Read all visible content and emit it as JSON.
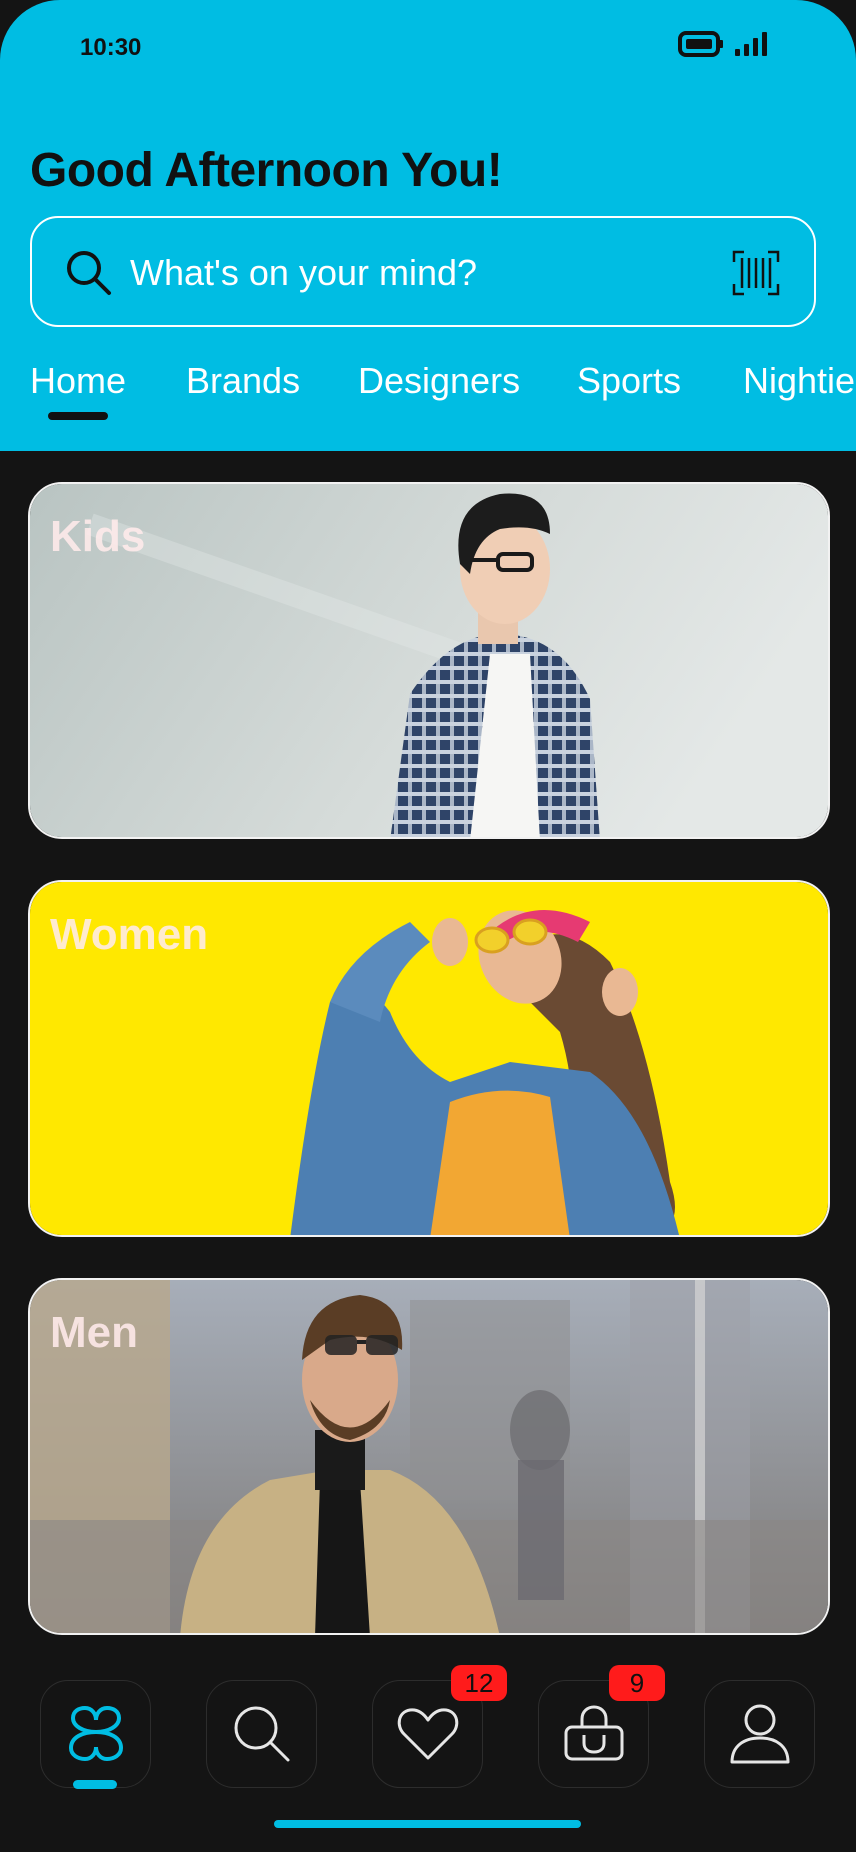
{
  "status_bar": {
    "time": "10:30"
  },
  "header": {
    "greeting": "Good Afternoon You!"
  },
  "search": {
    "placeholder": "What's on your mind?"
  },
  "tabs": [
    {
      "label": "Home",
      "active": true
    },
    {
      "label": "Brands"
    },
    {
      "label": "Designers"
    },
    {
      "label": "Sports"
    },
    {
      "label": "Nightie"
    }
  ],
  "categories": [
    {
      "label": "Kids",
      "image": "boy-leaning-on-wall-photo"
    },
    {
      "label": "Women",
      "image": "woman-yellow-background-photo"
    },
    {
      "label": "Men",
      "image": "man-city-street-photo"
    }
  ],
  "bottom_nav": [
    {
      "icon": "home-logo-icon",
      "active": true
    },
    {
      "icon": "search-icon"
    },
    {
      "icon": "heart-icon",
      "badge": "12"
    },
    {
      "icon": "shopping-bag-icon",
      "badge": "9"
    },
    {
      "icon": "profile-icon"
    }
  ],
  "colors": {
    "accent": "#00BDE3",
    "background": "#141414",
    "badge": "#FF1B1B",
    "women_card_bg": "#FFE800"
  }
}
